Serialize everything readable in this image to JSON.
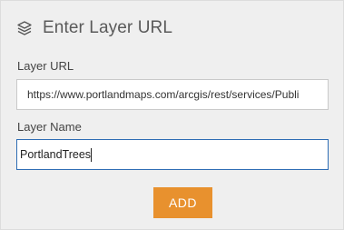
{
  "dialog": {
    "title": "Enter Layer URL",
    "icon": "layers-icon"
  },
  "fields": {
    "url": {
      "label": "Layer URL",
      "value": "https://www.portlandmaps.com/arcgis/rest/services/Publi"
    },
    "name": {
      "label": "Layer Name",
      "value": "PortlandTrees"
    }
  },
  "actions": {
    "add_label": "ADD"
  },
  "colors": {
    "panel_bg": "#efefef",
    "add_button_bg": "#e8912e",
    "focus_border": "#2e6db4"
  }
}
